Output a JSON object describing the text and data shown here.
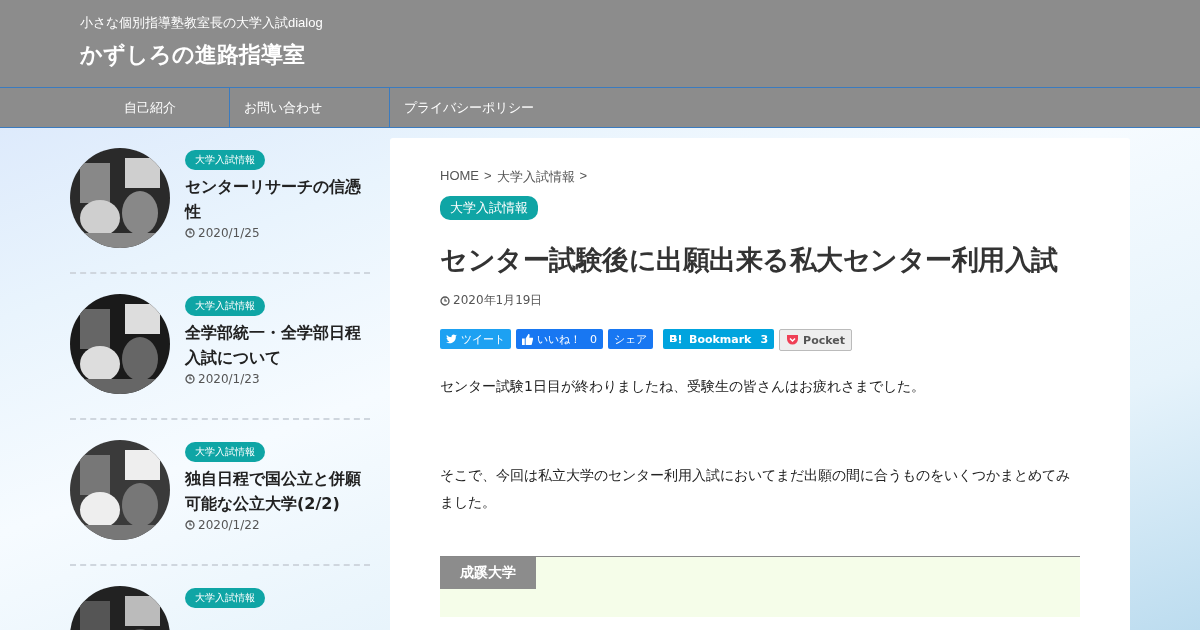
{
  "header": {
    "tagline": "小さな個別指導塾教室長の大学入試dialog",
    "site_title": "かずしろの進路指導室"
  },
  "nav": [
    {
      "label": "自己紹介"
    },
    {
      "label": "お問い合わせ"
    },
    {
      "label": "プライバシーポリシー"
    }
  ],
  "sidebar": {
    "posts": [
      {
        "category": "大学入試情報",
        "title": "センターリサーチの信憑性",
        "date": "2020/1/25"
      },
      {
        "category": "大学入試情報",
        "title": "全学部統一・全学部日程入試について",
        "date": "2020/1/23"
      },
      {
        "category": "大学入試情報",
        "title": "独自日程で国公立と併願可能な公立大学(2/2)",
        "date": "2020/1/22"
      },
      {
        "category": "大学入試情報"
      }
    ]
  },
  "article": {
    "breadcrumb": [
      {
        "label": "HOME"
      },
      {
        "label": ">"
      },
      {
        "label": "大学入試情報"
      },
      {
        "label": ">"
      }
    ],
    "category": "大学入試情報",
    "title": "センター試験後に出願出来る私大センター利用入試",
    "date": "2020年1月19日",
    "share_buttons": [
      {
        "kind": "twitter",
        "label": "ツイート"
      },
      {
        "kind": "like",
        "label": "いいね！",
        "count": "0"
      },
      {
        "kind": "share",
        "label": "シェア"
      },
      {
        "kind": "hatena",
        "label": "Bookmark",
        "count": "3"
      },
      {
        "kind": "pocket",
        "label": "Pocket"
      }
    ],
    "paragraphs": [
      "センター試験1日目が終わりましたね、受験生の皆さんはお疲れさまでした。",
      "そこで、今回は私立大学のセンター利用入試においてまだ出願の間に合うものをいくつかまとめてみました。"
    ],
    "section_heading": "成蹊大学"
  }
}
